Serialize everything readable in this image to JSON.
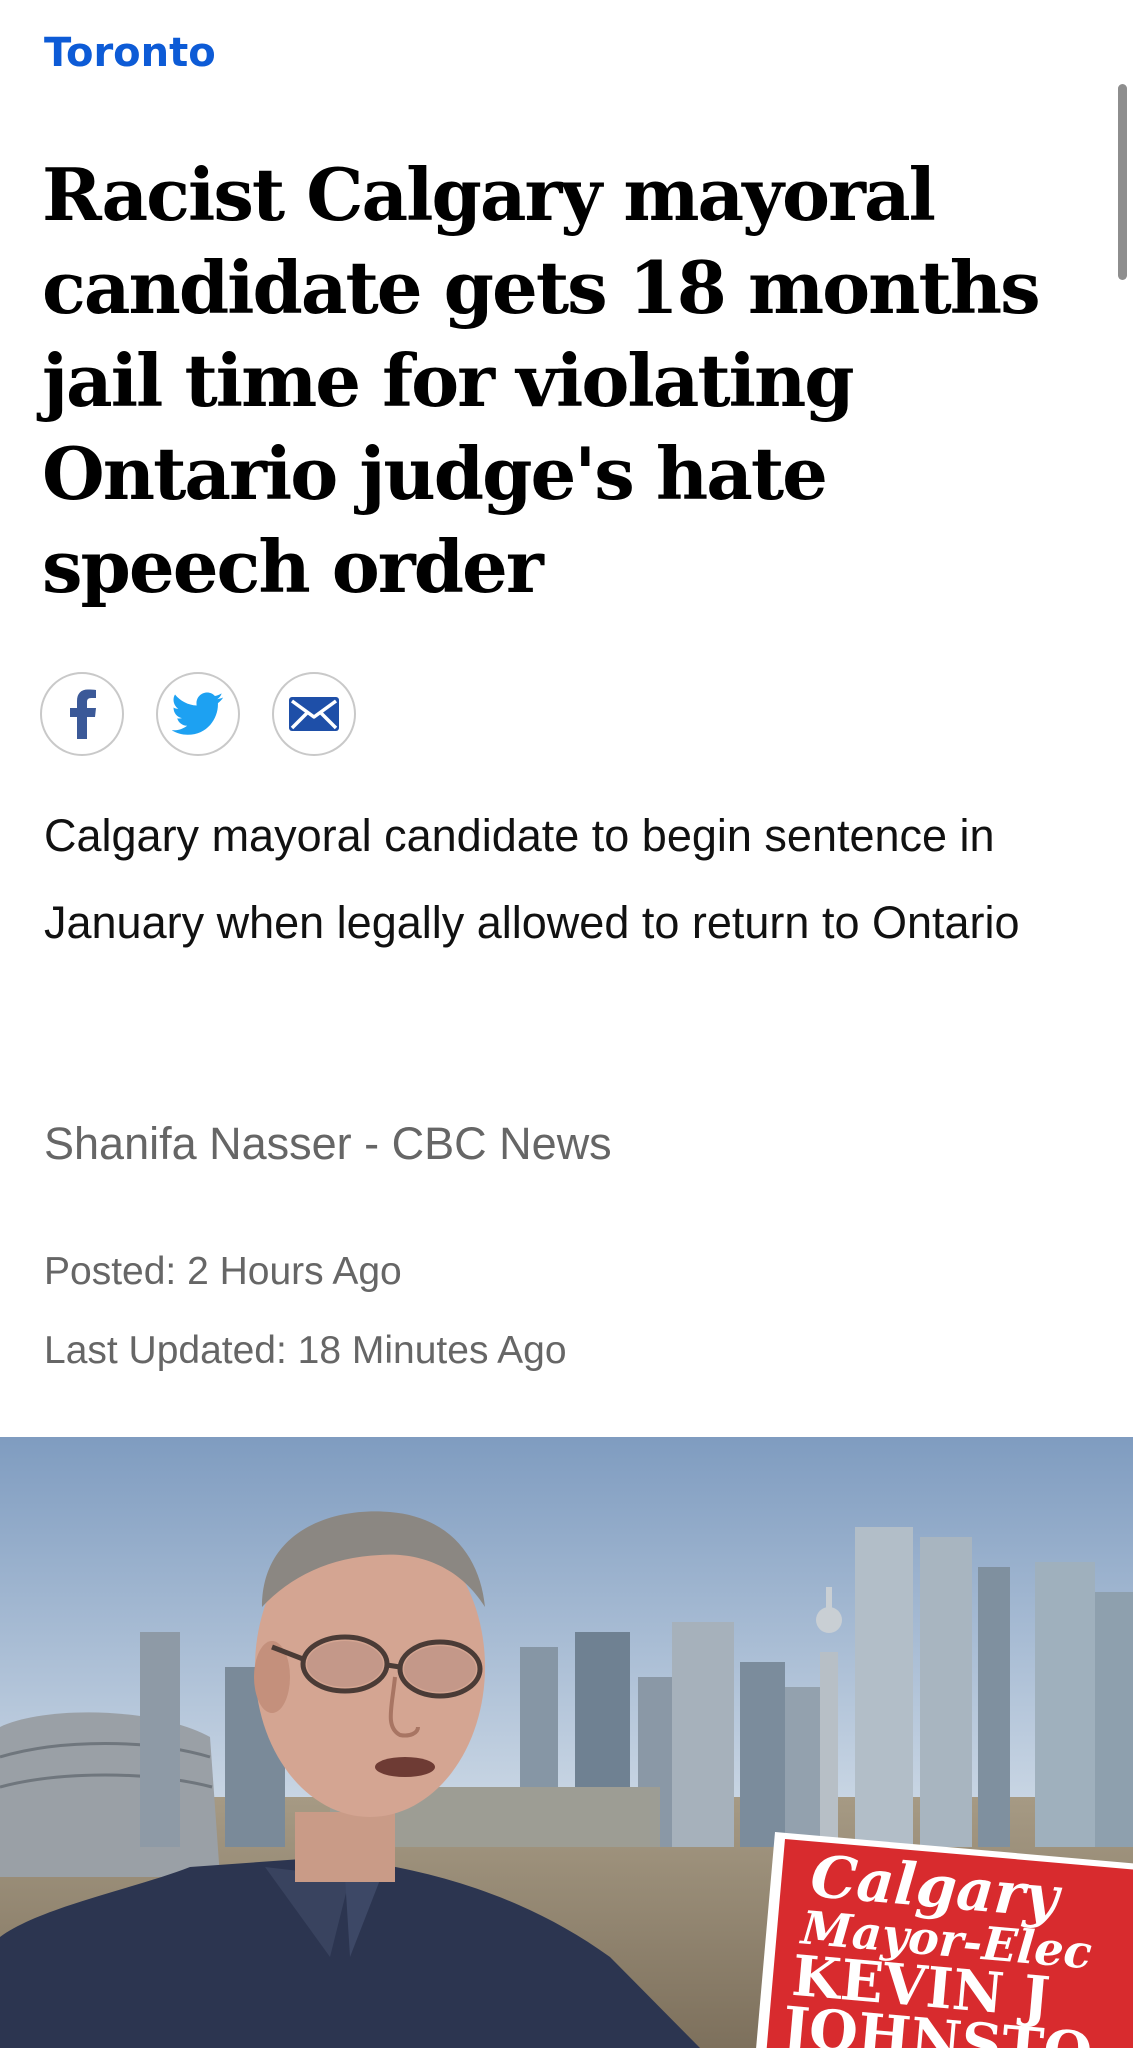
{
  "section": {
    "label": "Toronto"
  },
  "article": {
    "headline": "Racist Calgary mayoral candidate gets 18 months jail time for violating Ontario judge's hate speech order",
    "dek": "Calgary mayoral candidate to begin sentence in January when legally allowed to return to Ontario",
    "byline": "Shanifa Nasser - CBC News",
    "posted": "Posted: 2 Hours Ago",
    "updated": "Last Updated: 18 Minutes Ago"
  },
  "share": {
    "buttons": [
      {
        "icon": "facebook-icon",
        "color": "#3b5998"
      },
      {
        "icon": "twitter-icon",
        "color": "#1da1f2"
      },
      {
        "icon": "email-icon",
        "color": "#1e4fa8"
      }
    ]
  },
  "hero_image": {
    "sign_lines": [
      "Calgary",
      "Mayor-Elec",
      "KEVIN J",
      "JOHNSTO"
    ]
  },
  "colors": {
    "accent": "#0d5bd6",
    "meta_text": "#666666"
  }
}
